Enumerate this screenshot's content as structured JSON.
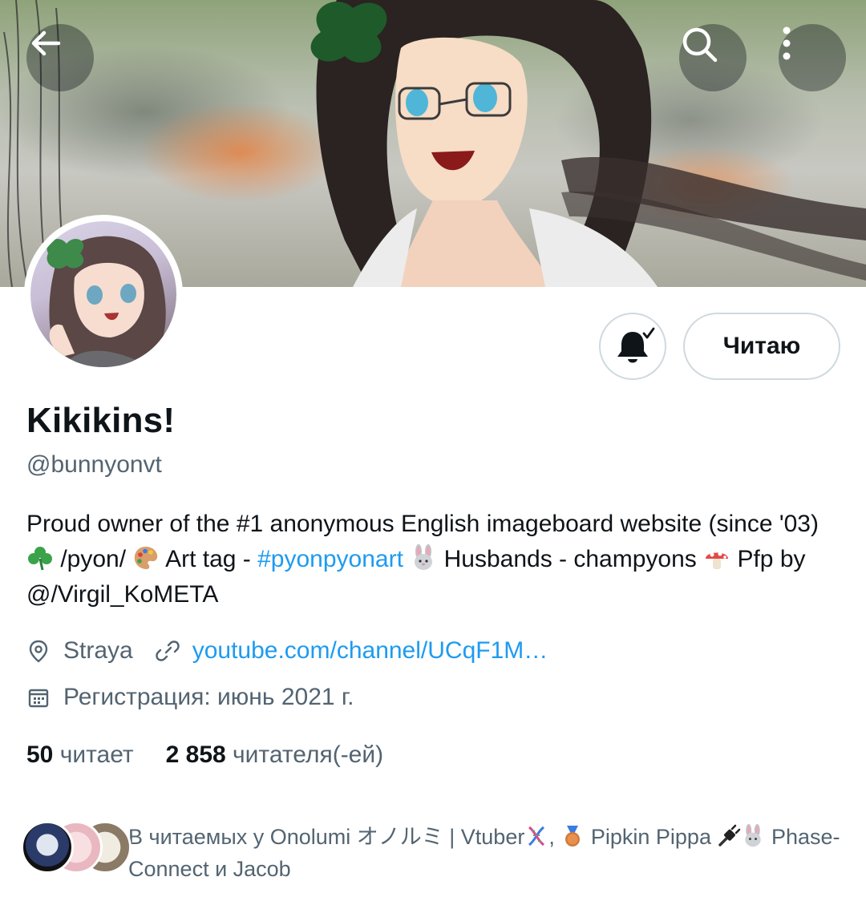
{
  "colors": {
    "link": "#1d9bf0",
    "secondary_text": "#536471",
    "primary_text": "#0f1419",
    "border": "#cfd9de"
  },
  "header": {
    "back_icon": "arrow-left-icon",
    "search_icon": "search-icon",
    "more_icon": "more-vertical-icon"
  },
  "profile": {
    "display_name": "Kikikins!",
    "handle": "@bunnyonvt",
    "follow_button_label": "Читаю",
    "notification_icon": "bell-check-icon",
    "bio": {
      "part1": "Proud owner of the #1 anonymous English imageboard website (since '03) ",
      "emoji1": "shamrock",
      "part2": " /pyon/ ",
      "emoji2": "artist-palette",
      "part3": " Art tag - ",
      "hashtag": "#pyonpyonart",
      "part4": " ",
      "emoji3": "rabbit-face",
      "part5": " Husbands - champyons ",
      "emoji4": "mushroom",
      "part6": " Pfp by @/Virgil_KoMETA"
    },
    "location": "Straya",
    "website": "youtube.com/channel/UCqF1M…",
    "joined": "Регистрация: июнь 2021 г.",
    "following_count": "50",
    "following_label": "читает",
    "followers_count": "2 858",
    "followers_label": "читателя(-ей)",
    "followed_by": {
      "part1": "В читаемых у Onolumi オノルミ | Vtuber",
      "emoji1": "dna",
      "part2": ", ",
      "emoji2": "third-place-medal",
      "part3": " Pipkin Pippa ",
      "emoji3": "electric-plug",
      "emoji4": "rabbit-face",
      "part4": " Phase-Connect и Jacob"
    }
  }
}
